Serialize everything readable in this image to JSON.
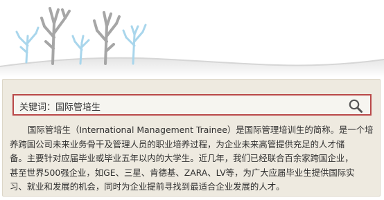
{
  "search": {
    "prefix": "关键词：",
    "keyword": "国际管培生"
  },
  "description": {
    "lines": [
      "国际管培生（International Management Trainee）是国际管理培训生的简称。是一个培",
      "养跨国公司未来业务骨干及管理人员的职业培养过程，为企业未来高管提供充足的人才储",
      "备。主要针对应届毕业或毕业五年以内的大学生。近几年，我们已经联合百余家跨国企业，",
      "甚至世界500强企业，如GE、三星、肯德基、ZARA、LV等，为广大应届毕业生提供国际实",
      "习、就业和发展的机会，同时为企业提前寻找到最适合企业发展的人才。"
    ]
  },
  "colors": {
    "panel_bg": "#eeeae0",
    "search_border": "#b94848",
    "tree_blue": "#9fd0e8",
    "tree_gray": "#a4a4a4"
  },
  "icons": {
    "search": "magnifier-icon"
  }
}
